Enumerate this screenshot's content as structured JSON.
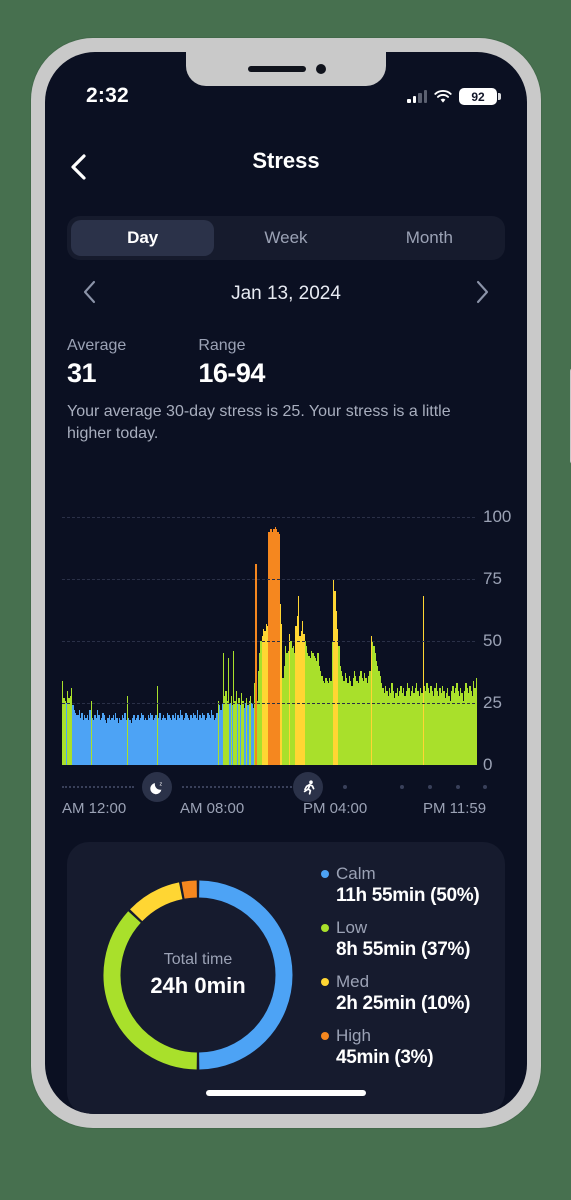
{
  "status_bar": {
    "time": "2:32",
    "battery_level": "92",
    "icons": [
      "signal-icon",
      "wifi-icon",
      "battery-icon"
    ]
  },
  "nav": {
    "back_icon": "back-chevron-icon",
    "title": "Stress"
  },
  "segmented": {
    "options": [
      "Day",
      "Week",
      "Month"
    ],
    "selected": "Day"
  },
  "date_nav": {
    "prev_icon": "chevron-left-icon",
    "next_icon": "chevron-right-icon",
    "label": "Jan 13, 2024"
  },
  "stats": {
    "average_label": "Average",
    "average_value": "31",
    "range_label": "Range",
    "range_value": "16-94",
    "summary": "Your average 30-day stress is 25. Your stress is a little higher today."
  },
  "colors": {
    "calm": "#4da3f5",
    "low": "#a9e02b",
    "med": "#ffd633",
    "high": "#f5871f",
    "screen_bg": "#0b1022",
    "card_bg": "#161b2e",
    "grid": "#2a3047",
    "muted_text": "#9ba2b5"
  },
  "timeline": {
    "sleep_icon": "moon-sleep-icon",
    "activity_icon": "running-person-icon"
  },
  "donut": {
    "center_label": "Total time",
    "center_value": "24h 0min"
  },
  "legend": [
    {
      "name": "Calm",
      "value": "11h 55min  (50%)",
      "color": "#4da3f5",
      "percent": 50
    },
    {
      "name": "Low",
      "value": "8h 55min  (37%)",
      "color": "#a9e02b",
      "percent": 37
    },
    {
      "name": "Med",
      "value": "2h 25min  (10%)",
      "color": "#ffd633",
      "percent": 10
    },
    {
      "name": "High",
      "value": "45min  (3%)",
      "color": "#f5871f",
      "percent": 3
    }
  ],
  "chart_data": {
    "type": "bar",
    "title": "",
    "xlabel": "",
    "ylabel": "",
    "ylim": [
      0,
      100
    ],
    "yticks": [
      "100",
      "75",
      "50",
      "25",
      "0"
    ],
    "grid": true,
    "xticks": [
      "AM 12:00",
      "AM 08:00",
      "PM 04:00",
      "PM 11:59"
    ],
    "legend_position": "bottom-card",
    "bands": {
      "calm": [
        0,
        25
      ],
      "low": [
        26,
        50
      ],
      "med": [
        51,
        75
      ],
      "high": [
        76,
        100
      ]
    },
    "values": [
      34,
      27,
      26,
      25,
      30,
      27,
      28,
      31,
      24,
      22,
      21,
      20,
      20,
      22,
      19,
      21,
      18,
      20,
      19,
      20,
      18,
      22,
      26,
      19,
      18,
      20,
      19,
      22,
      20,
      18,
      19,
      21,
      20,
      18,
      17,
      19,
      20,
      18,
      19,
      20,
      18,
      21,
      19,
      17,
      19,
      18,
      20,
      19,
      21,
      18,
      28,
      19,
      18,
      17,
      19,
      20,
      18,
      19,
      20,
      18,
      19,
      21,
      20,
      18,
      19,
      18,
      20,
      19,
      21,
      20,
      18,
      19,
      20,
      32,
      19,
      21,
      18,
      19,
      20,
      19,
      18,
      21,
      20,
      19,
      18,
      20,
      19,
      21,
      18,
      20,
      19,
      22,
      20,
      18,
      19,
      21,
      20,
      19,
      18,
      20,
      19,
      21,
      20,
      19,
      22,
      18,
      20,
      19,
      21,
      20,
      18,
      19,
      21,
      20,
      19,
      22,
      20,
      18,
      19,
      21,
      26,
      24,
      22,
      25,
      45,
      28,
      30,
      26,
      43,
      25,
      28,
      24,
      46,
      26,
      30,
      25,
      27,
      24,
      29,
      26,
      23,
      25,
      27,
      24,
      26,
      28,
      25,
      23,
      33,
      81,
      26,
      38,
      45,
      50,
      52,
      55,
      54,
      57,
      56,
      94,
      95,
      95,
      94,
      95,
      96,
      95,
      94,
      93,
      65,
      57,
      35,
      40,
      48,
      45,
      46,
      53,
      50,
      47,
      48,
      45,
      56,
      60,
      68,
      52,
      54,
      58,
      53,
      50,
      48,
      45,
      44,
      43,
      46,
      45,
      44,
      43,
      42,
      45,
      40,
      38,
      36,
      34,
      33,
      35,
      34,
      33,
      35,
      34,
      50,
      75,
      70,
      62,
      55,
      48,
      40,
      38,
      36,
      34,
      37,
      35,
      33,
      36,
      34,
      32,
      35,
      38,
      36,
      34,
      33,
      36,
      38,
      35,
      34,
      37,
      35,
      33,
      36,
      38,
      52,
      50,
      48,
      45,
      42,
      40,
      38,
      36,
      33,
      31,
      29,
      32,
      30,
      28,
      31,
      29,
      33,
      30,
      27,
      29,
      31,
      28,
      30,
      32,
      29,
      31,
      28,
      30,
      33,
      31,
      28,
      30,
      32,
      29,
      31,
      33,
      30,
      28,
      31,
      29,
      68,
      32,
      30,
      33,
      31,
      29,
      32,
      30,
      28,
      31,
      33,
      30,
      28,
      31,
      29,
      32,
      30,
      27,
      29,
      31,
      28,
      26,
      30,
      32,
      29,
      31,
      33,
      30,
      28,
      31,
      29,
      26,
      30,
      33,
      31,
      29,
      32,
      30,
      28,
      34,
      31,
      35
    ]
  }
}
